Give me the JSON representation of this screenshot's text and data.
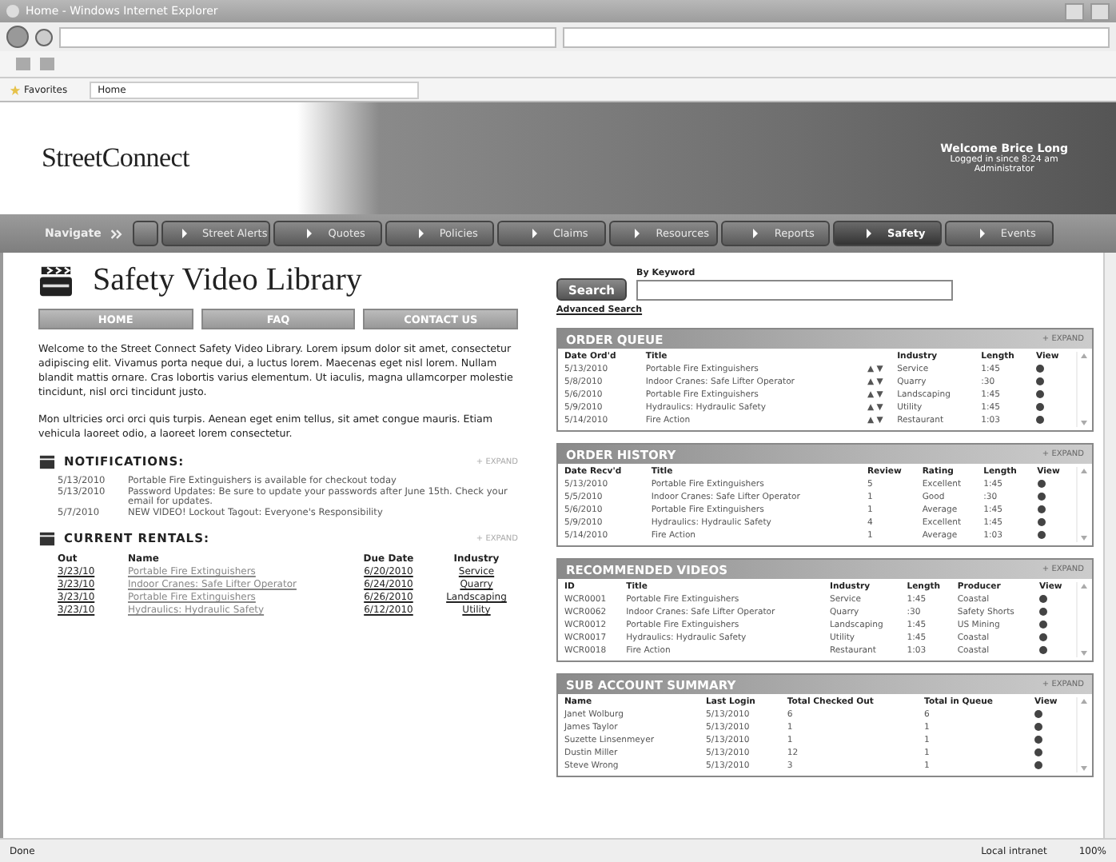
{
  "window": {
    "title": "Home - Windows Internet Explorer"
  },
  "favorites_bar": {
    "favorites": "Favorites",
    "tab": "Home"
  },
  "header": {
    "logo": "StreetConnect",
    "welcome": "Welcome Brice Long",
    "login": "Logged in since 8:24 am",
    "role": "Administrator"
  },
  "nav": {
    "label": "Navigate",
    "items": [
      {
        "label": "Street Alerts",
        "selected": false
      },
      {
        "label": "Quotes",
        "selected": false
      },
      {
        "label": "Policies",
        "selected": false
      },
      {
        "label": "Claims",
        "selected": false
      },
      {
        "label": "Resources",
        "selected": false
      },
      {
        "label": "Reports",
        "selected": false
      },
      {
        "label": "Safety",
        "selected": true
      },
      {
        "label": "Events",
        "selected": false
      }
    ]
  },
  "page_title": "Safety Video Library",
  "tabs": [
    "HOME",
    "FAQ",
    "CONTACT US"
  ],
  "intro": [
    "Welcome to the Street Connect Safety Video Library. Lorem ipsum dolor sit amet, consectetur adipiscing elit. Vivamus porta neque dui, a luctus lorem. Maecenas eget nisl lorem. Nullam blandit mattis ornare. Cras lobortis varius elementum. Ut iaculis, magna ullamcorper molestie tincidunt, nisl orci tincidunt justo.",
    "Mon ultricies orci orci quis turpis. Aenean eget enim tellus, sit amet congue mauris. Etiam vehicula laoreet odio, a laoreet lorem consectetur."
  ],
  "notifications": {
    "title": "NOTIFICATIONS:",
    "expand": "+ EXPAND",
    "items": [
      {
        "date": "5/13/2010",
        "text": "Portable Fire Extinguishers is available for checkout today"
      },
      {
        "date": "5/13/2010",
        "text": "Password Updates: Be sure to update your passwords after June 15th. Check your email for updates."
      },
      {
        "date": "5/7/2010",
        "text": "NEW VIDEO! Lockout Tagout: Everyone's Responsibility"
      }
    ]
  },
  "rentals": {
    "title": "CURRENT RENTALS:",
    "expand": "+ EXPAND",
    "columns": [
      "Out",
      "Name",
      "Due Date",
      "Industry"
    ],
    "rows": [
      [
        "3/23/10",
        "Portable Fire Extinguishers",
        "6/20/2010",
        "Service"
      ],
      [
        "3/23/10",
        "Indoor Cranes: Safe Lifter Operator",
        "6/24/2010",
        "Quarry"
      ],
      [
        "3/23/10",
        "Portable Fire Extinguishers",
        "6/26/2010",
        "Landscaping"
      ],
      [
        "3/23/10",
        "Hydraulics: Hydraulic Safety",
        "6/12/2010",
        "Utility"
      ]
    ]
  },
  "search": {
    "button": "Search",
    "label": "By Keyword",
    "advanced": "Advanced Search"
  },
  "panels": [
    {
      "title": "ORDER QUEUE",
      "expand": "+ EXPAND",
      "columns": [
        "Date Ord'd",
        "Title",
        "Industry",
        "Length",
        "View"
      ],
      "rows": [
        {
          "cells": [
            "5/13/2010",
            "Portable Fire Extinguishers",
            "Service",
            "1:45"
          ],
          "arrows": "▲ ▼"
        },
        {
          "cells": [
            "5/8/2010",
            "Indoor Cranes: Safe Lifter Operator",
            "Quarry",
            ":30"
          ],
          "arrows": "▲ ▼"
        },
        {
          "cells": [
            "5/6/2010",
            "Portable Fire Extinguishers",
            "Landscaping",
            "1:45"
          ],
          "arrows": "▲ ▼"
        },
        {
          "cells": [
            "5/9/2010",
            "Hydraulics: Hydraulic Safety",
            "Utility",
            "1:45"
          ],
          "arrows": "▲ ▼"
        },
        {
          "cells": [
            "5/14/2010",
            "Fire Action",
            "Restaurant",
            "1:03"
          ],
          "arrows": "▲ ▼"
        }
      ]
    },
    {
      "title": "ORDER HISTORY",
      "expand": "+ EXPAND",
      "columns": [
        "Date Recv'd",
        "Title",
        "Review",
        "Rating",
        "Length",
        "View"
      ],
      "rows": [
        {
          "cells": [
            "5/13/2010",
            "Portable Fire Extinguishers",
            "5",
            "Excellent",
            "1:45"
          ]
        },
        {
          "cells": [
            "5/5/2010",
            "Indoor Cranes: Safe Lifter Operator",
            "1",
            "Good",
            ":30"
          ]
        },
        {
          "cells": [
            "5/6/2010",
            "Portable Fire Extinguishers",
            "1",
            "Average",
            "1:45"
          ]
        },
        {
          "cells": [
            "5/9/2010",
            "Hydraulics: Hydraulic Safety",
            "4",
            "Excellent",
            "1:45"
          ]
        },
        {
          "cells": [
            "5/14/2010",
            "Fire Action",
            "1",
            "Average",
            "1:03"
          ]
        }
      ]
    },
    {
      "title": "RECOMMENDED VIDEOS",
      "expand": "+ EXPAND",
      "columns": [
        "ID",
        "Title",
        "Industry",
        "Length",
        "Producer",
        "View"
      ],
      "rows": [
        {
          "cells": [
            "WCR0001",
            "Portable Fire Extinguishers",
            "Service",
            "1:45",
            "Coastal"
          ]
        },
        {
          "cells": [
            "WCR0062",
            "Indoor Cranes: Safe Lifter Operator",
            "Quarry",
            ":30",
            "Safety Shorts"
          ]
        },
        {
          "cells": [
            "WCR0012",
            "Portable Fire Extinguishers",
            "Landscaping",
            "1:45",
            "US Mining"
          ]
        },
        {
          "cells": [
            "WCR0017",
            "Hydraulics: Hydraulic Safety",
            "Utility",
            "1:45",
            "Coastal"
          ]
        },
        {
          "cells": [
            "WCR0018",
            "Fire Action",
            "Restaurant",
            "1:03",
            "Coastal"
          ]
        }
      ]
    },
    {
      "title": "SUB ACCOUNT SUMMARY",
      "expand": "+ EXPAND",
      "columns": [
        "Name",
        "Last Login",
        "Total Checked Out",
        "Total in Queue",
        "View"
      ],
      "rows": [
        {
          "cells": [
            "Janet Wolburg",
            "5/13/2010",
            "6",
            "6"
          ]
        },
        {
          "cells": [
            "James Taylor",
            "5/13/2010",
            "1",
            "1"
          ]
        },
        {
          "cells": [
            "Suzette Linsenmeyer",
            "5/13/2010",
            "1",
            "1"
          ]
        },
        {
          "cells": [
            "Dustin Miller",
            "5/13/2010",
            "12",
            "1"
          ]
        },
        {
          "cells": [
            "Steve Wrong",
            "5/13/2010",
            "3",
            "1"
          ]
        }
      ]
    }
  ],
  "status_bar": {
    "status": "Done",
    "zone": "Local intranet",
    "zoom": "100%"
  }
}
